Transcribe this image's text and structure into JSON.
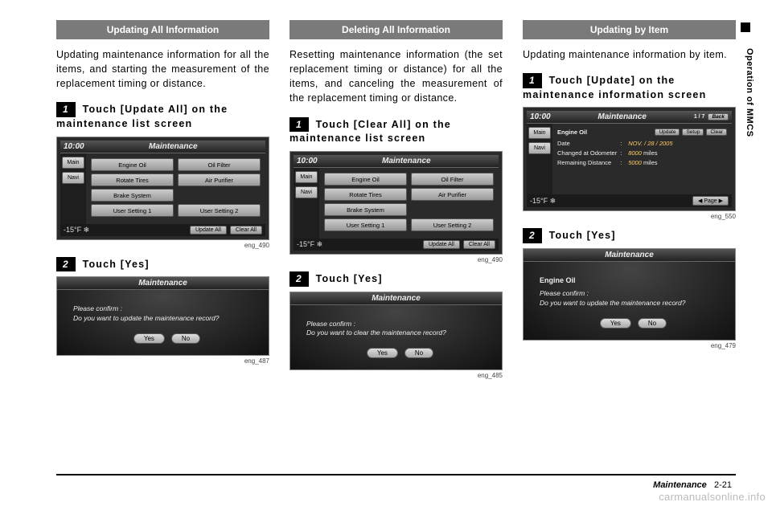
{
  "sideTab": "Operation of MMCS",
  "footer": {
    "label": "Maintenance",
    "page": "2-21"
  },
  "watermark": "carmanualsonline.info",
  "screens": {
    "clock": "10:00",
    "title": "Maintenance",
    "temp": "-15°F ❄",
    "sideMain": "Main",
    "sideNavi": "Navi",
    "back": "Back",
    "page": "1 / 7",
    "items": {
      "engineOil": "Engine Oil",
      "oilFilter": "Oil Filter",
      "rotateTires": "Rotate Tires",
      "airPurifier": "Air Purifier",
      "brakeSystem": "Brake System",
      "user1": "User Setting 1",
      "user2": "User Setting 2"
    },
    "footerBtns": {
      "updateAll": "Update All",
      "clearAll": "Clear All"
    },
    "info": {
      "update": "Update",
      "setup": "Setup",
      "clear": "Clear",
      "dateLabel": "Date",
      "dateVal": "NOV. / 28 / 2005",
      "odoLabel": "Changed at Odometer",
      "odoVal": "8000",
      "odoUnit": "miles",
      "remLabel": "Remaining Distance",
      "remVal": "5000",
      "remUnit": "miles",
      "pager": "◀ Page ▶"
    },
    "confirm": {
      "lead": "Please confirm :",
      "updateQ": "Do you want to update the maintenance record?",
      "clearQ": "Do you want to clear the maintenance record?",
      "yes": "Yes",
      "no": "No"
    }
  },
  "col1": {
    "header": "Updating All Information",
    "body": "Updating maintenance information for all the items, and starting the measurement of the replacement timing or distance.",
    "step1": "Touch [Update All] on the maintenance list screen",
    "cap1": "eng_490",
    "step2": "Touch [Yes]",
    "cap2": "eng_487"
  },
  "col2": {
    "header": "Deleting All Information",
    "body": "Resetting maintenance information (the set replacement timing or distance) for all the items, and canceling the measurement of the replacement timing or distance.",
    "step1": "Touch [Clear All] on the maintenance list screen",
    "cap1": "eng_490",
    "step2": "Touch [Yes]",
    "cap2": "eng_485"
  },
  "col3": {
    "header": "Updating by Item",
    "body": "Updating maintenance information by item.",
    "step1": "Touch [Update] on the maintenance information screen",
    "cap1": "eng_550",
    "step2": "Touch [Yes]",
    "cap2": "eng_479"
  }
}
